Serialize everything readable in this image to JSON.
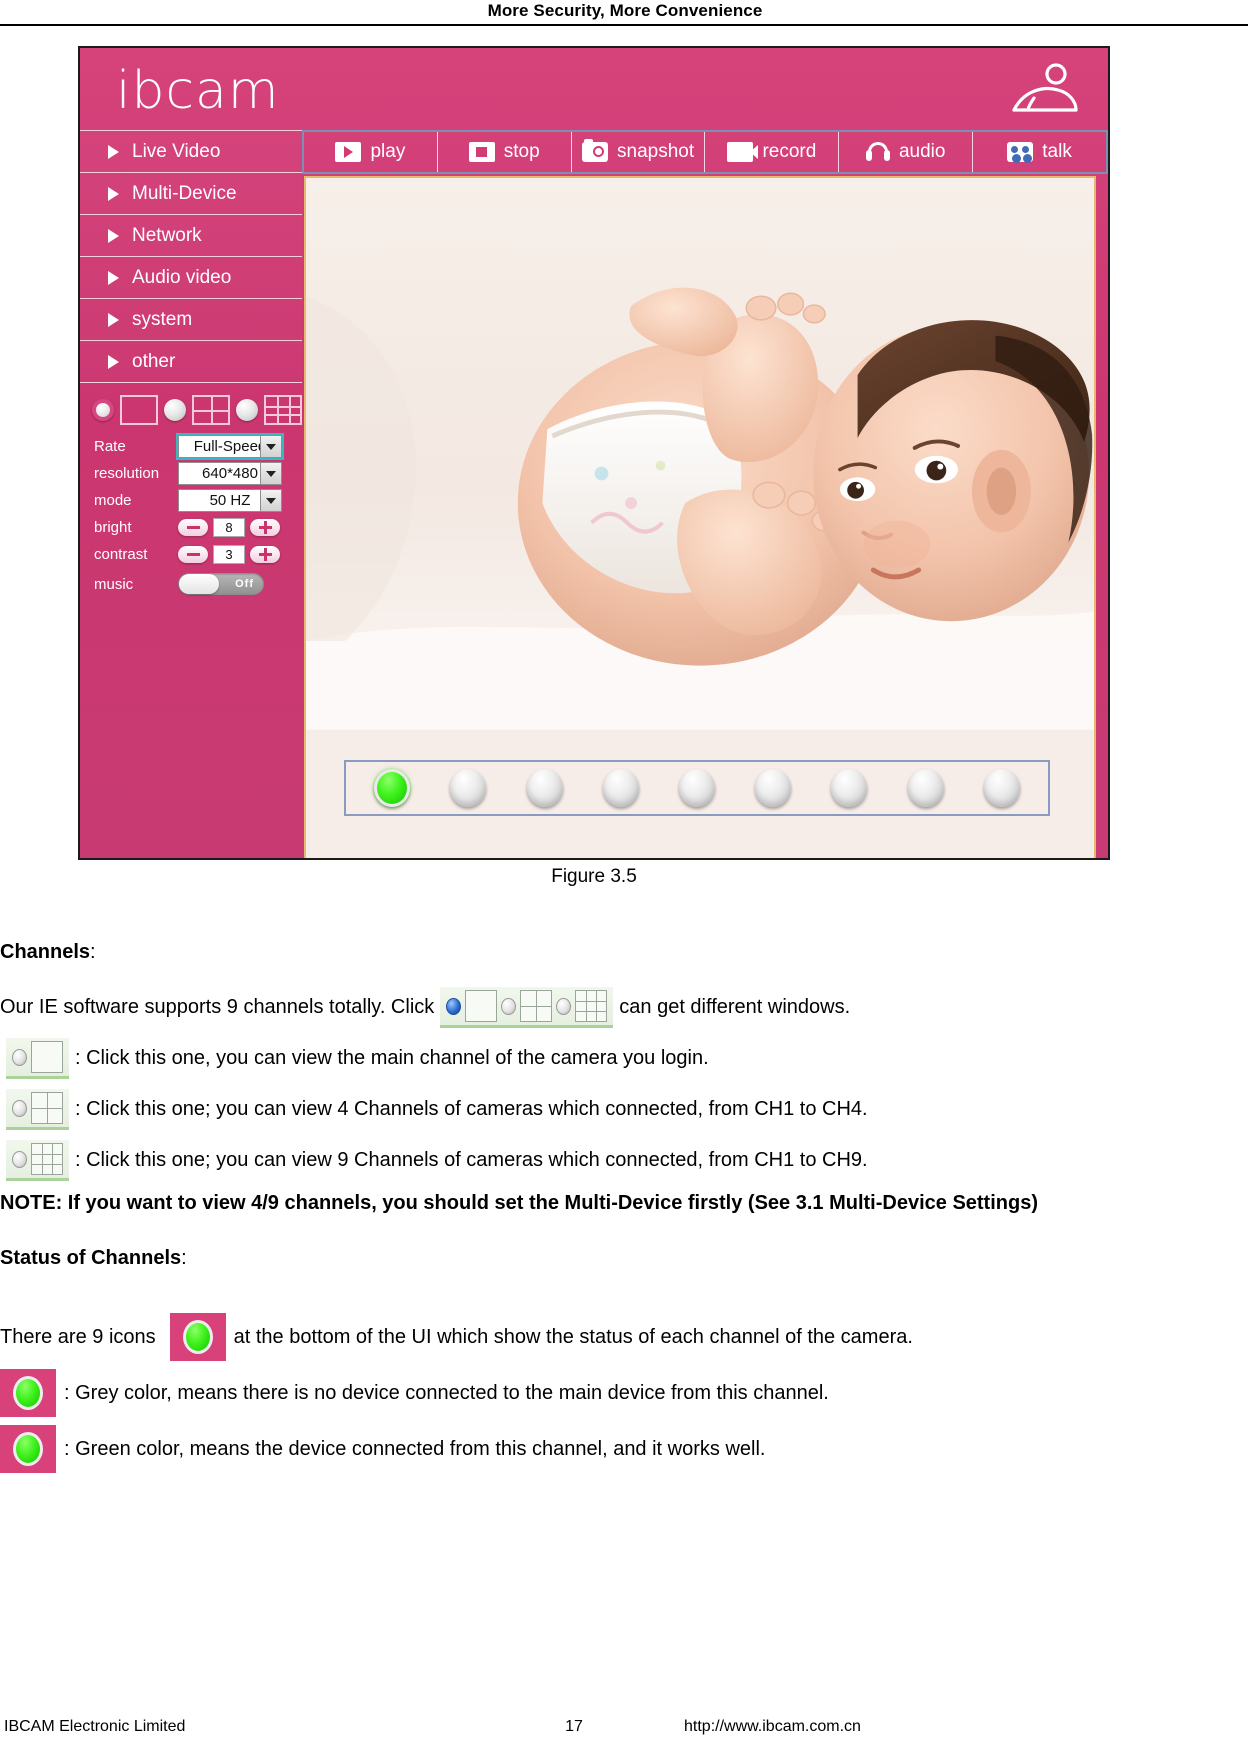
{
  "page": {
    "header_title": "More Security, More Convenience",
    "figure_caption": "Figure 3.5"
  },
  "screenshot": {
    "logo": "ibcam",
    "logo_icon": "baby-lying-icon",
    "sidebar": {
      "items": [
        {
          "label": "Live Video",
          "icon": "triangle-right-icon"
        },
        {
          "label": "Multi-Device",
          "icon": "triangle-right-icon"
        },
        {
          "label": "Network",
          "icon": "triangle-right-icon"
        },
        {
          "label": "Audio video",
          "icon": "triangle-right-icon"
        },
        {
          "label": "system",
          "icon": "triangle-right-icon"
        },
        {
          "label": "other",
          "icon": "triangle-right-icon"
        }
      ]
    },
    "toolbar": {
      "buttons": [
        {
          "label": "play",
          "icon": "play-icon"
        },
        {
          "label": "stop",
          "icon": "stop-icon"
        },
        {
          "label": "snapshot",
          "icon": "camera-icon"
        },
        {
          "label": "record",
          "icon": "camcorder-icon"
        },
        {
          "label": "audio",
          "icon": "headphone-icon"
        },
        {
          "label": "talk",
          "icon": "people-talk-icon"
        }
      ]
    },
    "view_modes": [
      {
        "name": "single-channel-view",
        "icon": "radio-knob-icon",
        "selected": true
      },
      {
        "name": "four-channel-view",
        "icon": "grid-4-icon",
        "selected": false
      },
      {
        "name": "nine-channel-view",
        "icon": "grid-9-icon",
        "selected": false
      }
    ],
    "settings": {
      "rate": {
        "label": "Rate",
        "value": "Full-Speed"
      },
      "resolution": {
        "label": "resolution",
        "value": "640*480"
      },
      "mode": {
        "label": "mode",
        "value": "50 HZ"
      },
      "bright": {
        "label": "bright",
        "value": "8"
      },
      "contrast": {
        "label": "contrast",
        "value": "3"
      },
      "music": {
        "label": "music",
        "value": "Off"
      }
    },
    "channel_lamps": [
      {
        "channel": "CH1",
        "state": "green"
      },
      {
        "channel": "CH2",
        "state": "grey"
      },
      {
        "channel": "CH3",
        "state": "grey"
      },
      {
        "channel": "CH4",
        "state": "grey"
      },
      {
        "channel": "CH5",
        "state": "grey"
      },
      {
        "channel": "CH6",
        "state": "grey"
      },
      {
        "channel": "CH7",
        "state": "grey"
      },
      {
        "channel": "CH8",
        "state": "grey"
      },
      {
        "channel": "CH9",
        "state": "grey"
      }
    ],
    "colors": {
      "brand_pink": "#d23b74",
      "toolbar_border": "#7d8fb5",
      "video_border": "#e8b96d",
      "lamp_green": "#3ff21c"
    }
  },
  "content": {
    "channels_heading": "Channels",
    "channels_heading_colon": ":",
    "intro_before": "Our IE software supports 9 channels totally. Click",
    "intro_after": "can get different windows.",
    "bullet1": ": Click this one, you can view the main channel of the camera you login.",
    "bullet2": ": Click this one; you can view 4 Channels of cameras which connected, from CH1 to CH4.",
    "bullet3": ": Click this one; you can view 9 Channels of cameras which connected, from CH1 to CH9.",
    "note_label": "NOTE",
    "note_text": ": If you want to view 4/9 channels, you should set the Multi-Device firstly (See 3.1 Multi-Device Settings)",
    "status_heading": "Status of Channels",
    "status_heading_colon": ":",
    "status_before": "There are 9 icons",
    "status_after": "at the bottom of the UI which show the status of each channel of the camera.",
    "grey_desc": ": Grey color, means there is no device connected to the main device from this channel.",
    "green_desc": ": Green color, means the device connected from this channel, and it works well."
  },
  "footer": {
    "company": "IBCAM Electronic Limited",
    "page_number": "17",
    "website": "http://www.ibcam.com.cn"
  }
}
